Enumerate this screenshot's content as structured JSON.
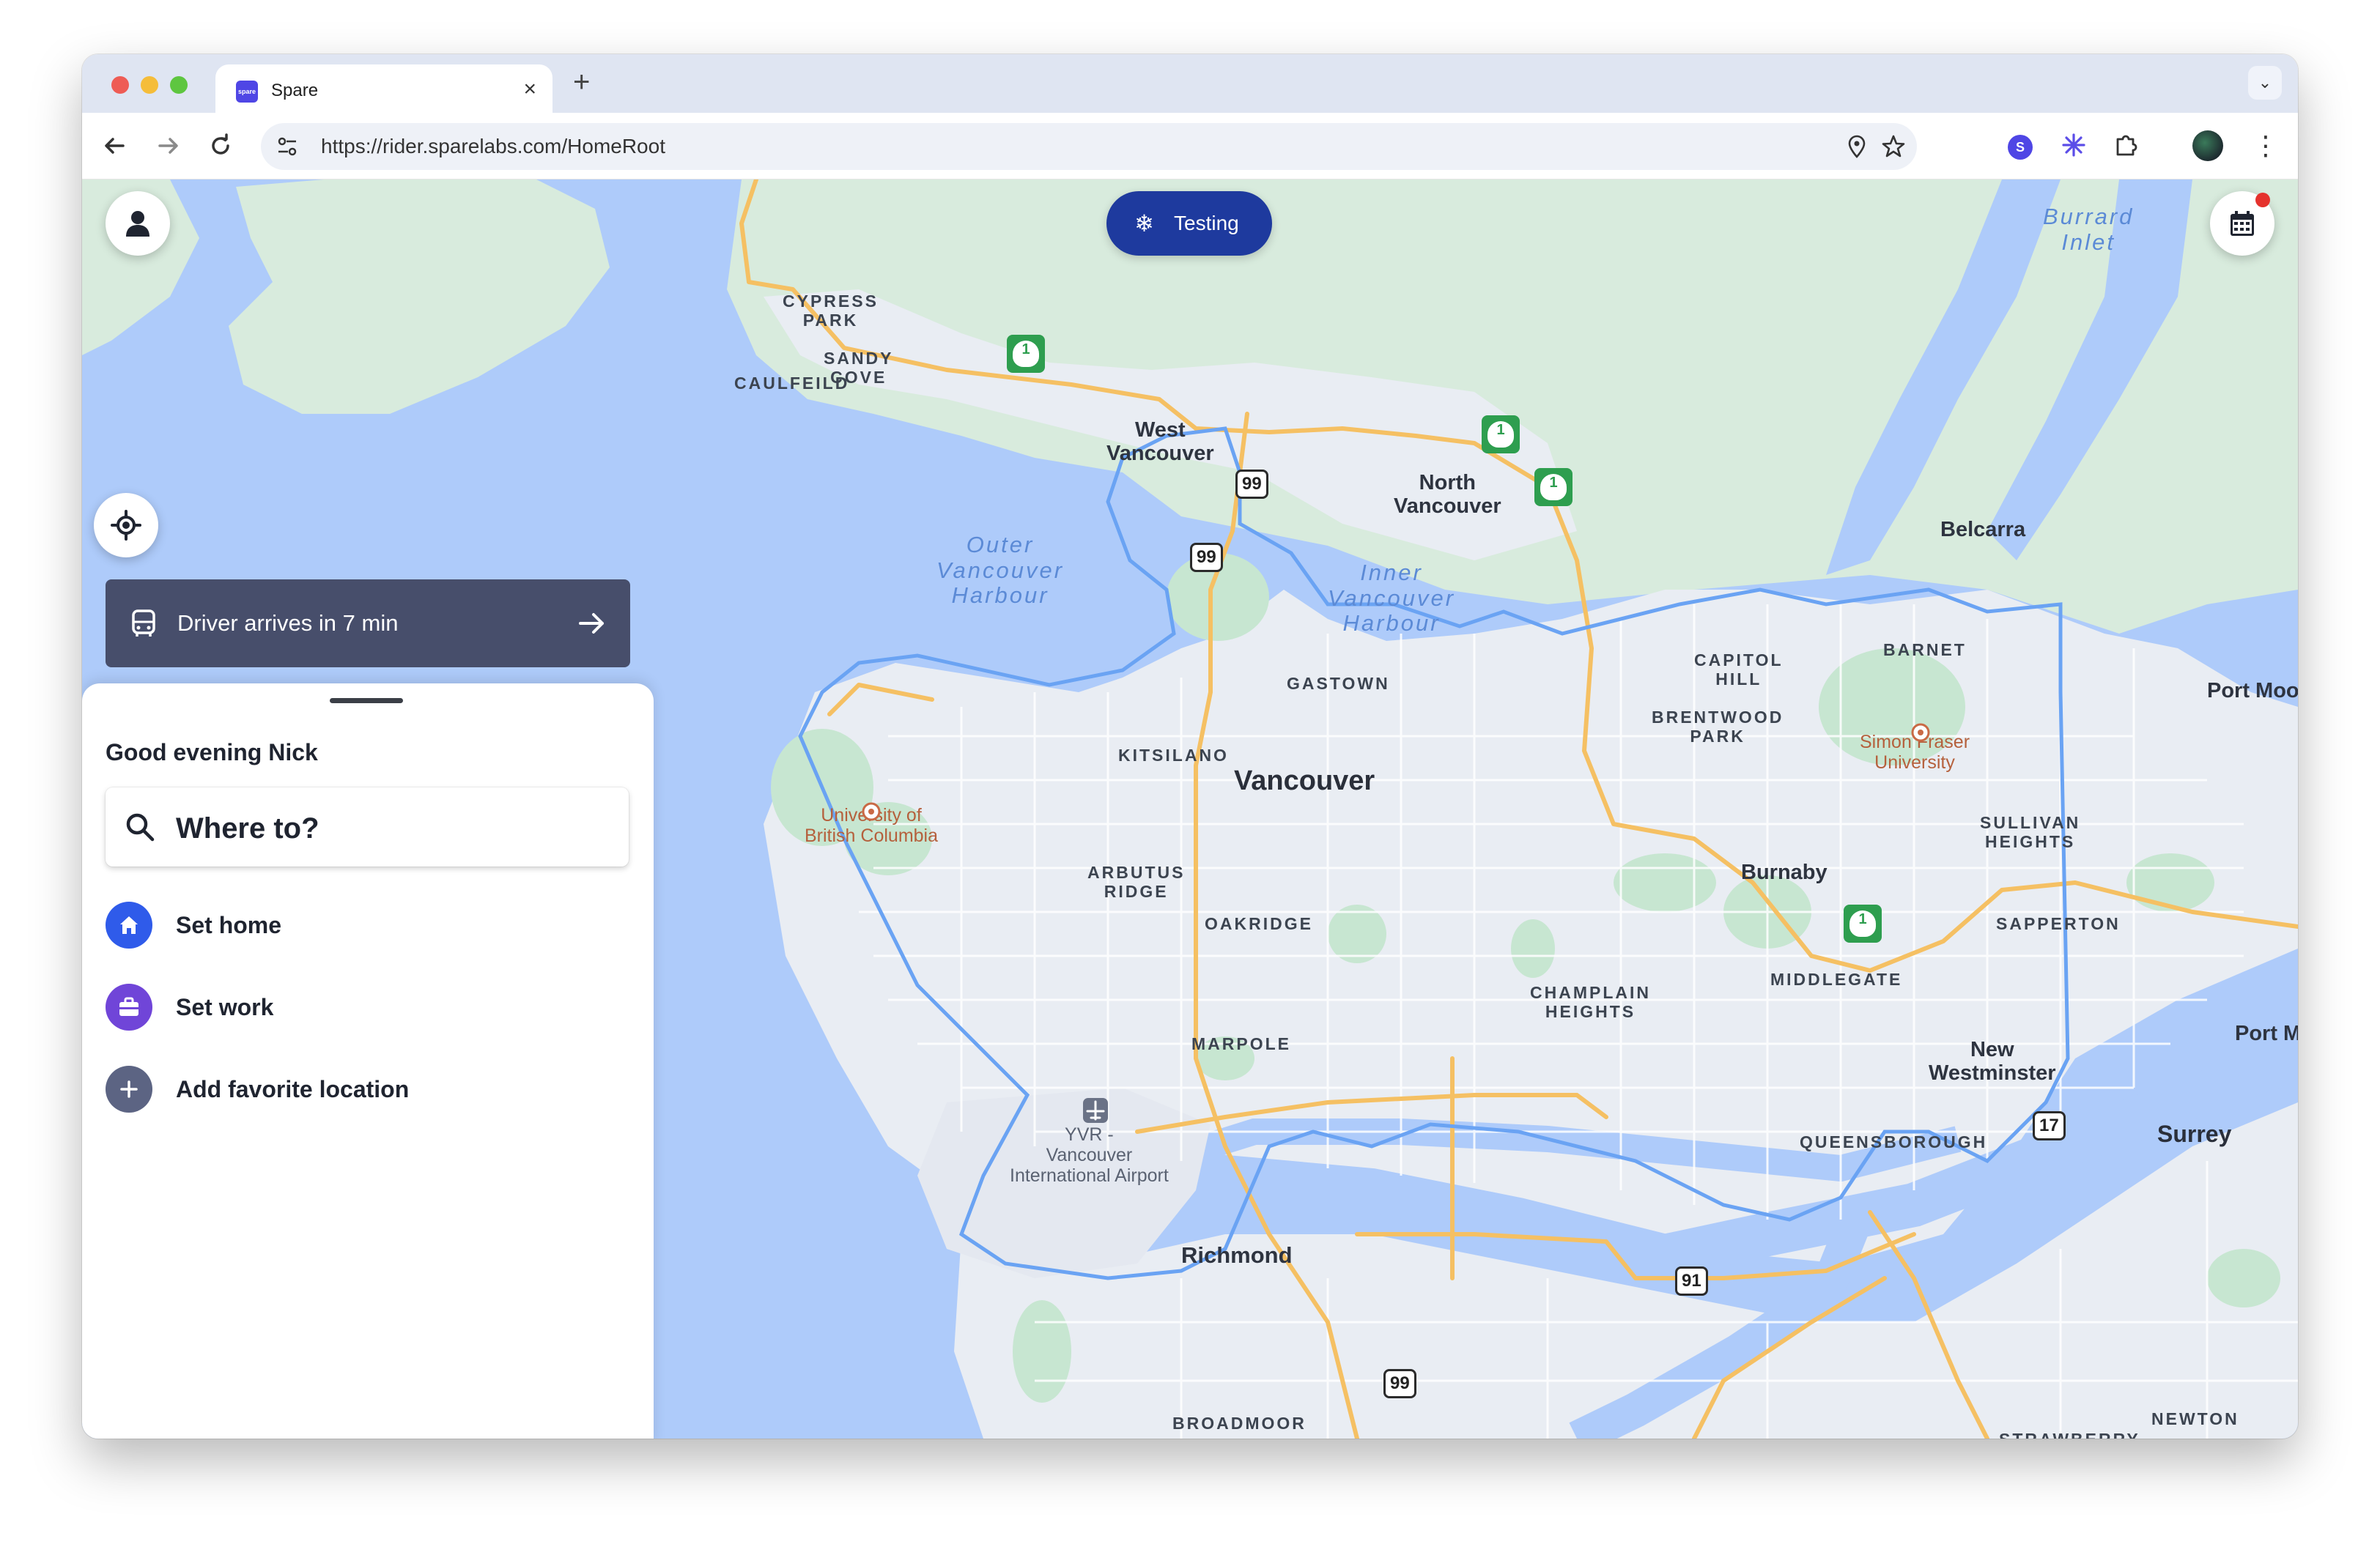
{
  "browser": {
    "tab_title": "Spare",
    "favicon_text": "spare",
    "url": "https://rider.sparelabs.com/HomeRoot",
    "extension_badge": "S"
  },
  "app": {
    "testing_label": "Testing",
    "driver_banner": "Driver arrives in 7 min",
    "greeting": "Good evening Nick",
    "search_placeholder": "Where to?",
    "favorites": [
      {
        "label": "Set home",
        "icon": "home-icon",
        "color": "#2f5bea"
      },
      {
        "label": "Set work",
        "icon": "briefcase-icon",
        "color": "#7045d8"
      },
      {
        "label": "Add favorite location",
        "icon": "plus-icon",
        "color": "#5c6483"
      }
    ],
    "colors": {
      "accent_blue": "#1e3a9e",
      "banner_bg": "#474e6b",
      "notification_dot": "#e5322d"
    }
  },
  "map": {
    "labels": {
      "cypress_park": "CYPRESS\nPARK",
      "sandy_cove": "SANDY\nCOVE",
      "caulfeild": "CAULFEILD",
      "west_vancouver": "West\nVancouver",
      "north_vancouver": "North\nVancouver",
      "belcarra": "Belcarra",
      "burrard_inlet": "Burrard\nInlet",
      "outer_harbour": "Outer\nVancouver\nHarbour",
      "inner_harbour": "Inner\nVancouver\nHarbour",
      "capitol_hill": "CAPITOL\nHILL",
      "barnet": "BARNET",
      "port_moody": "Port Moo",
      "brentwood": "BRENTWOOD\nPARK",
      "gastown": "GASTOWN",
      "kitsilano": "KITSILANO",
      "vancouver": "Vancouver",
      "sfu": "Simon Fraser\nUniversity",
      "ubc": "University of\nBritish Columbia",
      "sullivan": "SULLIVAN\nHEIGHTS",
      "burnaby": "Burnaby",
      "arbutus": "ARBUTUS\nRIDGE",
      "oakridge": "OAKRIDGE",
      "sapperton": "SAPPERTON",
      "middlegate": "MIDDLEGATE",
      "champlain": "CHAMPLAIN\nHEIGHTS",
      "port_mann": "Port M",
      "marpole": "MARPOLE",
      "new_westminster": "New\nWestminster",
      "yvr": "YVR -\nVancouver\nInternational Airport",
      "queensborough": "QUEENSBOROUGH",
      "surrey": "Surrey",
      "richmond": "Richmond",
      "broadmoor": "BROADMOOR",
      "newton": "NEWTON",
      "strawberry": "STRAWBERRY"
    },
    "highway_shields": {
      "hwy99_a": "99",
      "hwy99_b": "99",
      "hwy99_c": "99",
      "hwy91": "91",
      "hwy17": "17",
      "tch": "1"
    }
  }
}
